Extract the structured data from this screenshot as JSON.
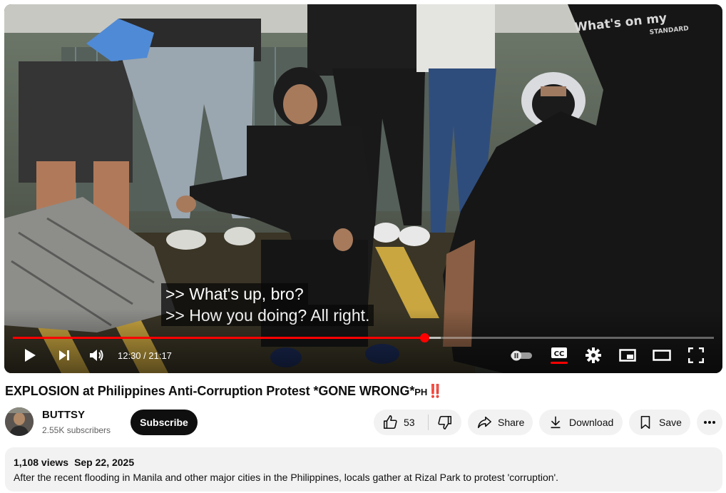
{
  "video": {
    "captions": [
      ">> What's up, bro?",
      ">> How you doing? All right."
    ],
    "time_current": "12:30",
    "time_total": "21:17",
    "time_display": "12:30 / 21:17",
    "progress_fraction": 0.587,
    "buffer_fraction": 0.61,
    "shirt_text": "What's on my",
    "shirt_subtext": "STANDARD",
    "controls": [
      "play-icon",
      "next-icon",
      "volume-icon",
      "autoplay-toggle",
      "cc-icon",
      "settings-icon",
      "miniplayer-icon",
      "theater-icon",
      "fullscreen-icon"
    ]
  },
  "title": {
    "text": "EXPLOSION at Philippines Anti-Corruption Protest *GONE WRONG*",
    "suffix": "PH",
    "emoji": "‼️"
  },
  "channel": {
    "name": "BUTTSY",
    "subscribers": "2.55K subscribers",
    "subscribe_label": "Subscribe"
  },
  "actions": {
    "like_count": "53",
    "share_label": "Share",
    "download_label": "Download",
    "save_label": "Save"
  },
  "description": {
    "views": "1,108 views",
    "date": "Sep 22, 2025",
    "text": "After the recent flooding in Manila and other major cities in the Philippines, locals gather at Rizal Park to protest 'corruption'."
  },
  "colors": {
    "accent_red": "#ff0000",
    "subscribe_bg": "#0f0f0f",
    "pill_bg": "#f2f2f2"
  }
}
